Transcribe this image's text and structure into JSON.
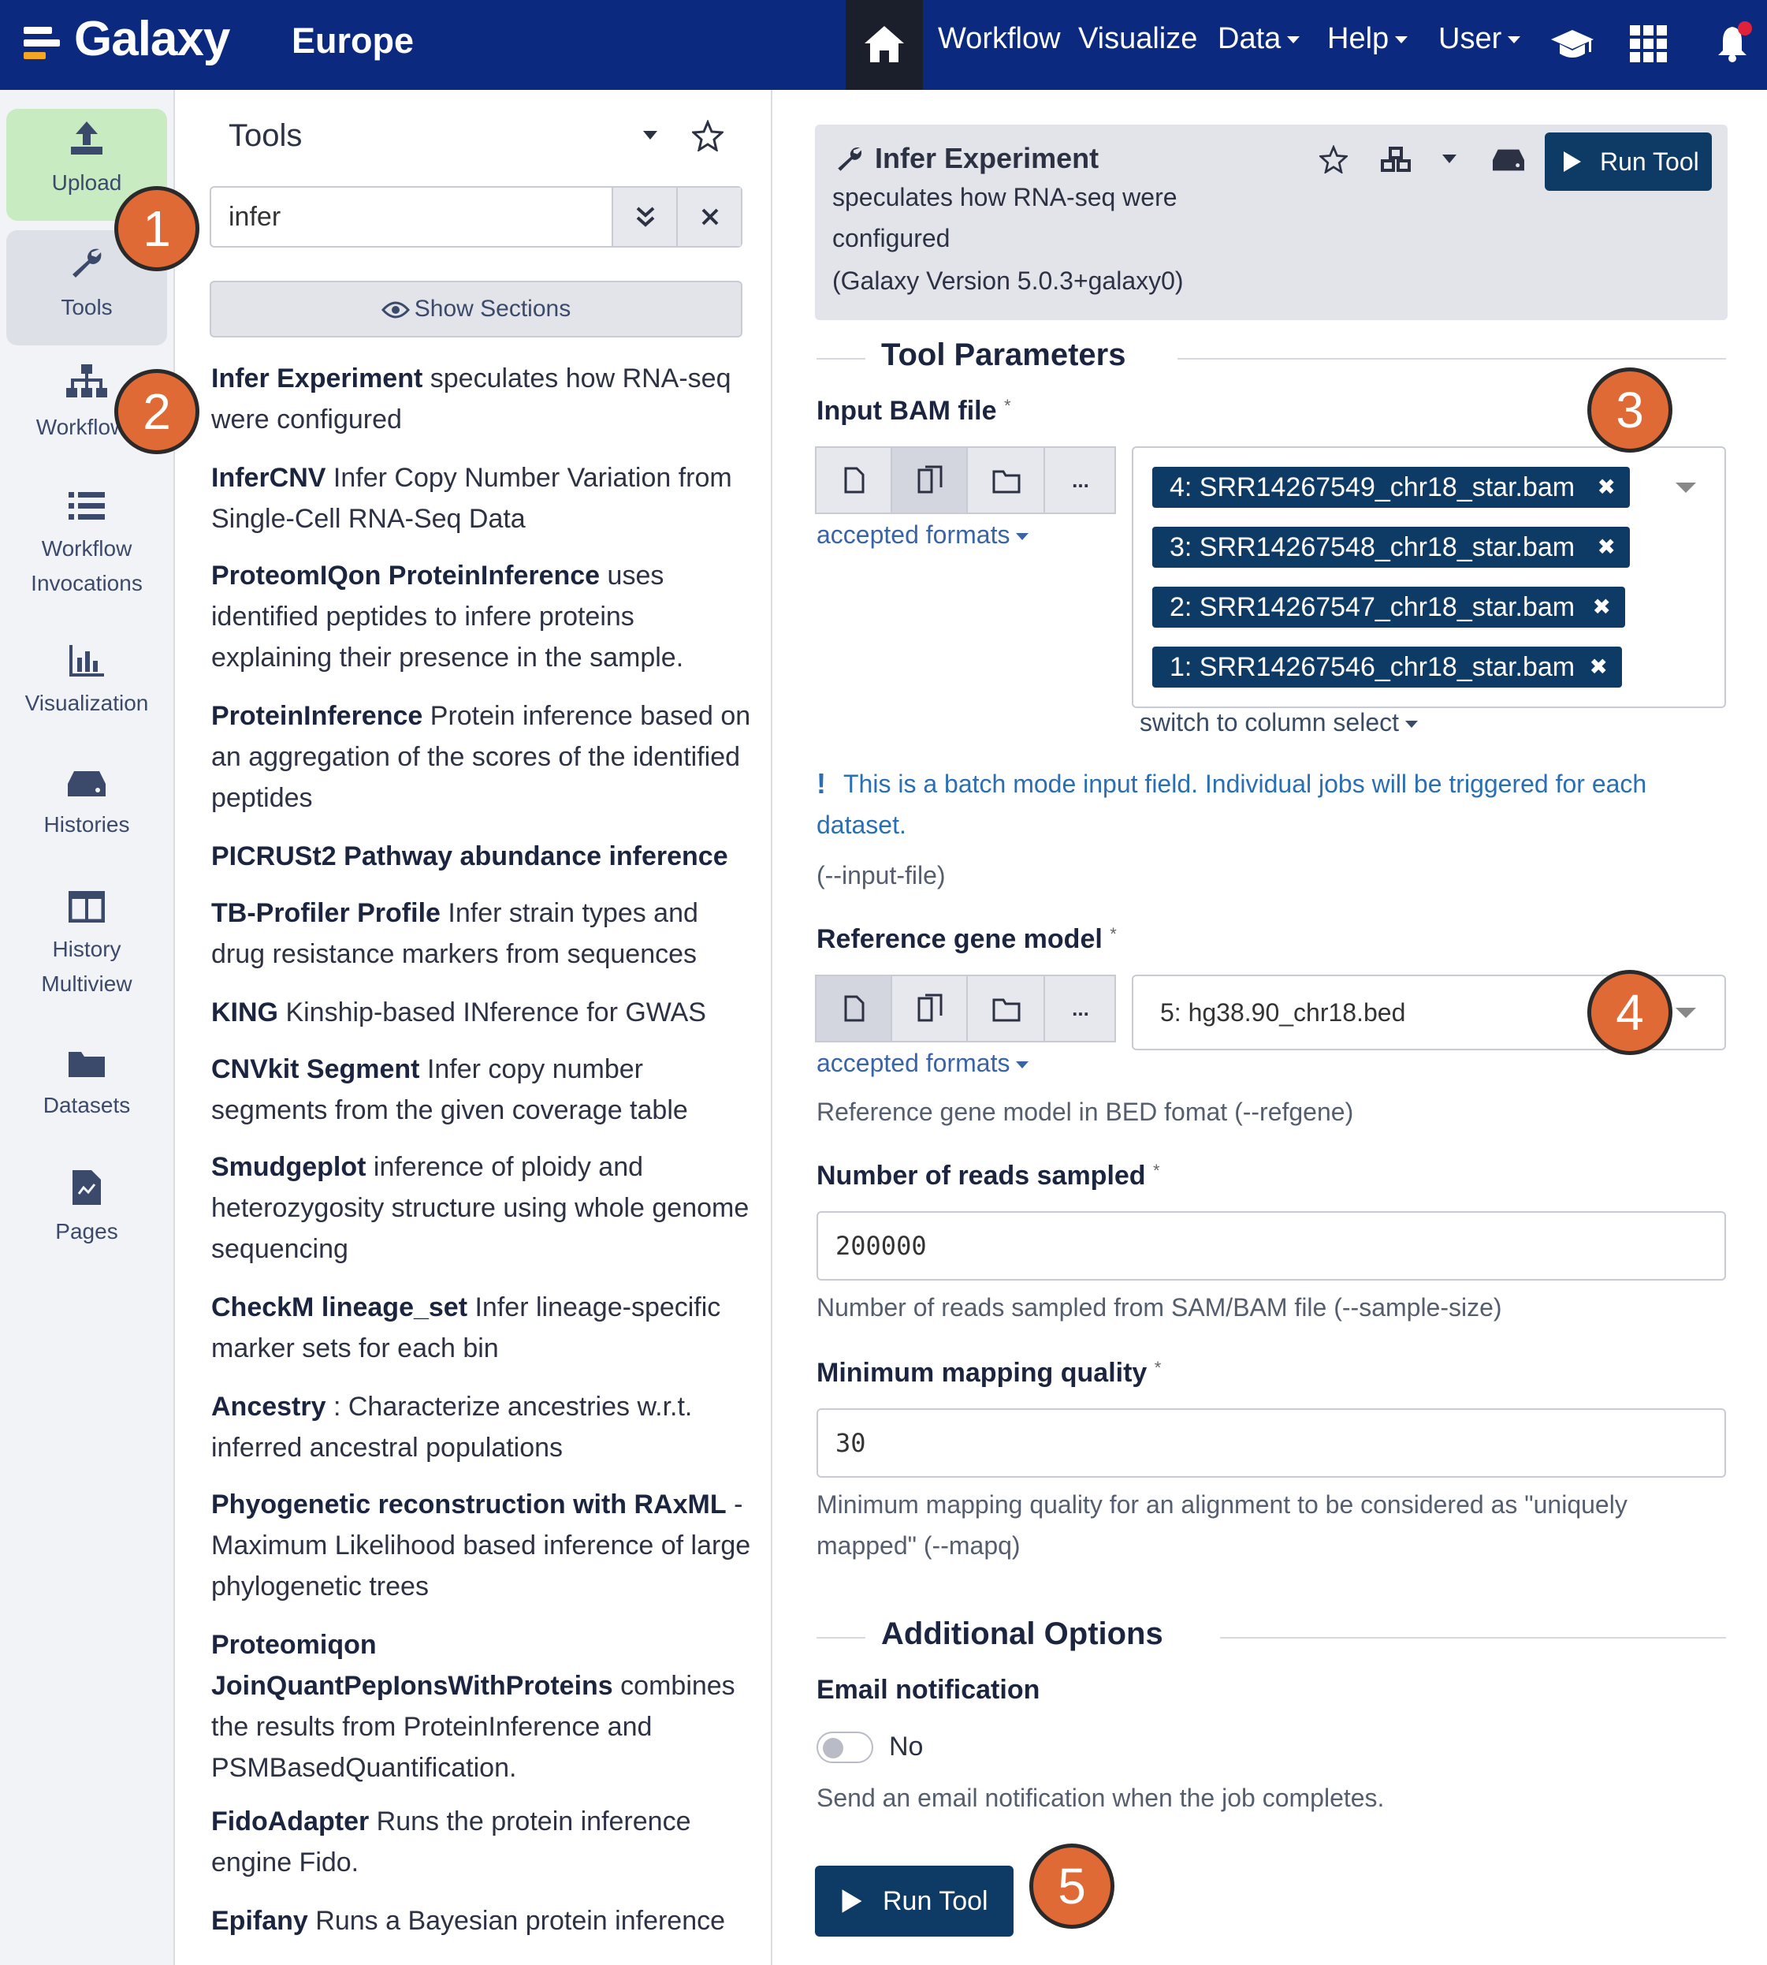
{
  "header": {
    "brand": "Galaxy",
    "instance": "Europe",
    "nav": [
      {
        "label": "Workflow",
        "dropdown": false
      },
      {
        "label": "Visualize",
        "dropdown": false
      },
      {
        "label": "Data",
        "dropdown": true
      },
      {
        "label": "Help",
        "dropdown": true
      },
      {
        "label": "User",
        "dropdown": true
      }
    ],
    "icons": [
      "home-icon",
      "graduation-cap-icon",
      "grid-icon",
      "bell-icon"
    ]
  },
  "activity_bar": [
    {
      "label": "Upload",
      "icon": "upload-icon"
    },
    {
      "label": "Tools",
      "icon": "wrench-icon"
    },
    {
      "label": "Workflows",
      "icon": "sitemap-icon"
    },
    {
      "label": "Workflow Invocations",
      "icon": "list-icon"
    },
    {
      "label": "Visualization",
      "icon": "chart-icon"
    },
    {
      "label": "Histories",
      "icon": "hdd-icon"
    },
    {
      "label": "History Multiview",
      "icon": "columns-icon"
    },
    {
      "label": "Datasets",
      "icon": "folder-icon"
    },
    {
      "label": "Pages",
      "icon": "file-icon"
    }
  ],
  "tool_panel": {
    "title": "Tools",
    "search_value": "infer",
    "show_sections": "Show Sections",
    "results": [
      {
        "name": "Infer Experiment",
        "desc": "speculates how RNA-seq were configured"
      },
      {
        "name": "InferCNV",
        "desc": "Infer Copy Number Variation from Single-Cell RNA-Seq Data"
      },
      {
        "name": "ProteomIQon ProteinInference",
        "desc": "uses identified peptides to infere proteins explaining their presence in the sample."
      },
      {
        "name": "ProteinInference",
        "desc": "Protein inference based on an aggregation of the scores of the identified peptides"
      },
      {
        "name": "PICRUSt2 Pathway abundance inference",
        "desc": ""
      },
      {
        "name": "TB-Profiler Profile",
        "desc": "Infer strain types and drug resistance markers from sequences"
      },
      {
        "name": "KING",
        "desc": "Kinship-based INference for GWAS"
      },
      {
        "name": "CNVkit Segment",
        "desc": "Infer copy number segments from the given coverage table"
      },
      {
        "name": "Smudgeplot",
        "desc": "inference of ploidy and heterozygosity structure using whole genome sequencing"
      },
      {
        "name": "CheckM lineage_set",
        "desc": "Infer lineage-specific marker sets for each bin"
      },
      {
        "name": "Ancestry",
        "desc": ": Characterize ancestries w.r.t. inferred ancestral populations"
      },
      {
        "name": "Phyogenetic reconstruction with RAxML",
        "desc": "- Maximum Likelihood based inference of large phylogenetic trees"
      },
      {
        "name": "Proteomiqon JoinQuantPepIonsWithProteins",
        "desc": "combines the results from ProteinInference and PSMBasedQuantification."
      },
      {
        "name": "FidoAdapter",
        "desc": "Runs the protein inference engine Fido."
      },
      {
        "name": "Epifany",
        "desc": "Runs a Bayesian protein inference"
      }
    ]
  },
  "tool_form": {
    "name": "Infer Experiment",
    "desc_line1": "speculates how RNA-seq were",
    "desc_line2": "configured",
    "version": "(Galaxy Version 5.0.3+galaxy0)",
    "run_label": "Run Tool",
    "section_params": "Tool Parameters",
    "input_bam": {
      "label": "Input BAM file",
      "required": "*",
      "accepted": "accepted formats",
      "selected": [
        "4: SRR14267549_chr18_star.bam",
        "3: SRR14267548_chr18_star.bam",
        "2: SRR14267547_chr18_star.bam",
        "1: SRR14267546_chr18_star.bam"
      ],
      "switch_label": "switch to column select",
      "batch_note": "This is a batch mode input field. Individual jobs will be triggered for each dataset.",
      "arg": "(--input-file)"
    },
    "refgene": {
      "label": "Reference gene model",
      "required": "*",
      "accepted": "accepted formats",
      "value": "5: hg38.90_chr18.bed",
      "help": "Reference gene model in BED fomat (--refgene)"
    },
    "reads": {
      "label": "Number of reads sampled",
      "required": "*",
      "value": "200000",
      "help": "Number of reads sampled from SAM/BAM file (--sample-size)"
    },
    "mapq": {
      "label": "Minimum mapping quality",
      "required": "*",
      "value": "30",
      "help_line1": "Minimum mapping quality for an alignment to be considered as \"uniquely",
      "help_line2": "mapped\" (--mapq)"
    },
    "section_additional": "Additional Options",
    "email": {
      "label": "Email notification",
      "toggle_value": "No",
      "help": "Send an email notification when the job completes."
    },
    "run_bottom": "Run Tool"
  },
  "markers": [
    "1",
    "2",
    "3",
    "4",
    "5"
  ],
  "colors": {
    "header": "#0b2a7f",
    "accent": "#0e3a66",
    "marker": "#e06a35",
    "upload": "#c9ebc2"
  }
}
